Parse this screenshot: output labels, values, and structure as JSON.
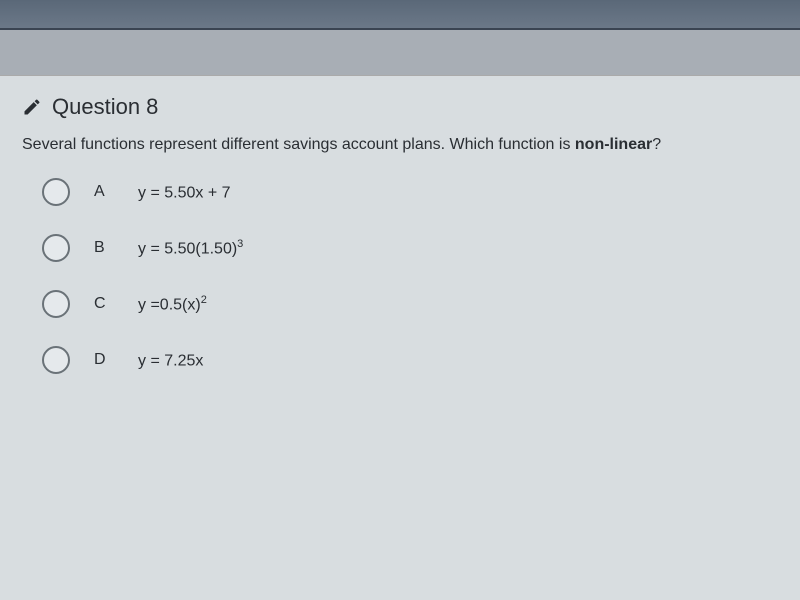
{
  "question": {
    "number": "Question 8",
    "prompt_prefix": "Several functions represent different savings account plans. Which function is ",
    "prompt_bold": "non-linear",
    "prompt_suffix": "?"
  },
  "options": [
    {
      "letter": "A",
      "expr_pre": "y = 5.50x + 7",
      "sup": ""
    },
    {
      "letter": "B",
      "expr_pre": "y = 5.50(1.50)",
      "sup": "3"
    },
    {
      "letter": "C",
      "expr_pre": "y =0.5(x)",
      "sup": "2"
    },
    {
      "letter": "D",
      "expr_pre": "y = 7.25x",
      "sup": ""
    }
  ]
}
